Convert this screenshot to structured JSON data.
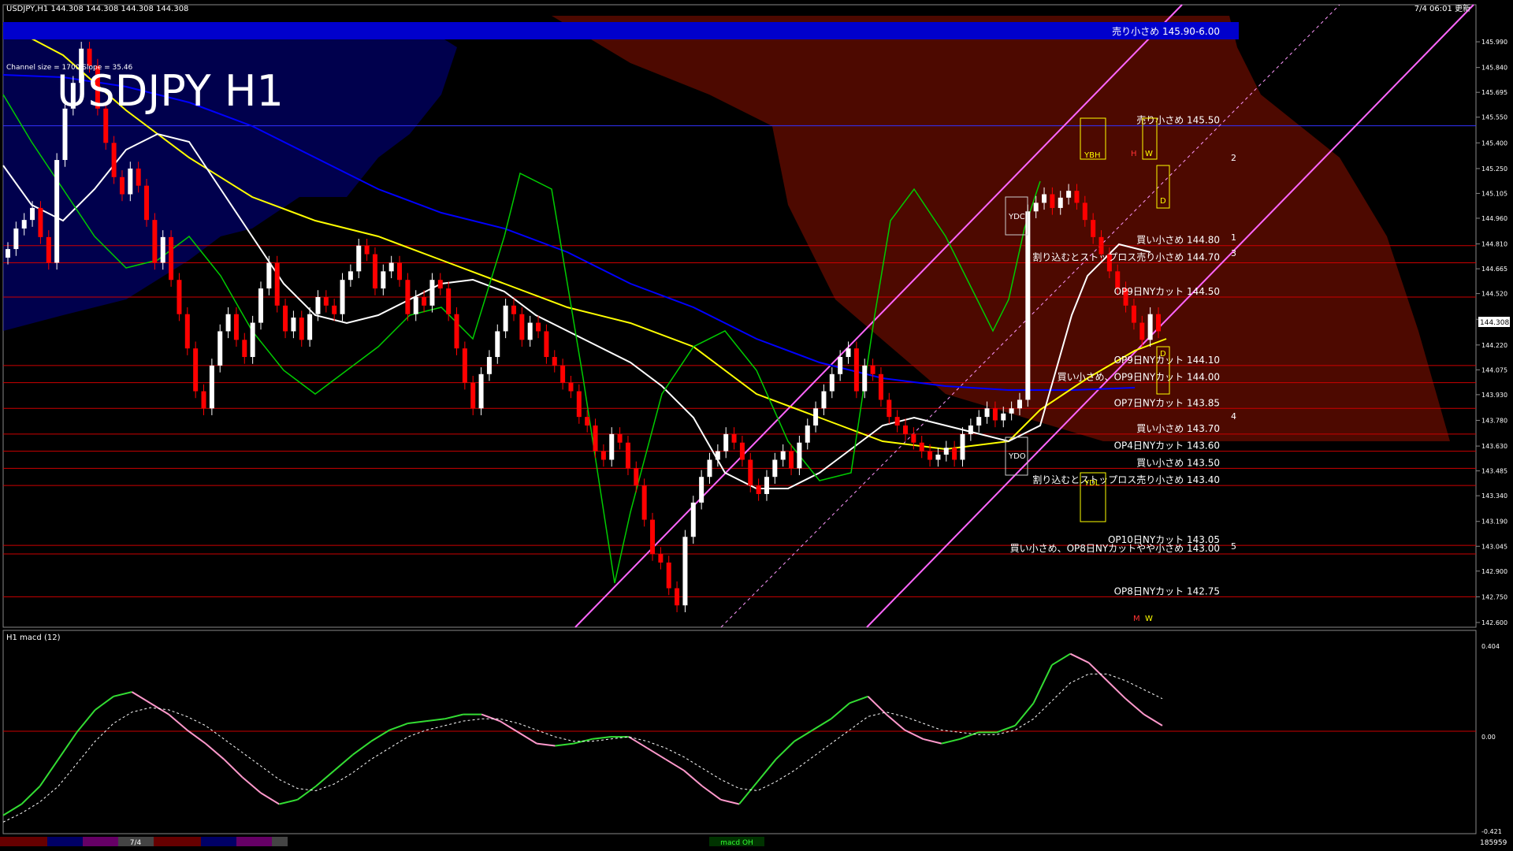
{
  "header": {
    "symbol_info": "USDJPY,H1  144.308 144.308 144.308 144.308",
    "time_info": "7/4 06:01 更新",
    "channel_info": "Channel size = 1700 Slope = 35.46",
    "big_title": "USDJPY H1",
    "current_price": "144.308"
  },
  "colors": {
    "background": "#000000",
    "bull_candle": "#ffffff",
    "bear_candle": "#ff0000",
    "sma_short": "#ffffff",
    "sma_mid": "#ffff00",
    "sma_long": "#0000ff",
    "chikou": "#00cc00",
    "channel": "#ff66ff",
    "level_line": "#cc0000",
    "band_banner": "#0000cc",
    "macd_up": "#33dd33",
    "macd_down": "#ff99cc",
    "macd_signal": "#ffffff"
  },
  "banner": {
    "label": "売り小さめ 145.90-6.00"
  },
  "markers": {
    "channel_numbers": [
      "1",
      "2",
      "3",
      "4",
      "5"
    ],
    "box_labels": [
      "YDC",
      "YDO",
      "YBH",
      "YDL",
      "D",
      "D",
      "W",
      "H",
      "M",
      "W"
    ]
  },
  "time_tabs": [
    "",
    "",
    "",
    "7/4",
    "",
    "",
    "",
    "",
    ""
  ],
  "status_item": "macd OH",
  "bottom_counter": "185959",
  "chart_data": {
    "type": "candlestick",
    "title": "USDJPY H1",
    "ylim": [
      142.6,
      146.05
    ],
    "y_ticks": [
      "145.990",
      "145.840",
      "145.695",
      "145.550",
      "145.400",
      "145.250",
      "145.105",
      "144.960",
      "144.810",
      "144.665",
      "144.520",
      "144.370",
      "144.220",
      "144.075",
      "143.930",
      "143.780",
      "143.630",
      "143.485",
      "143.340",
      "143.190",
      "143.045",
      "142.900",
      "142.750",
      "142.600"
    ],
    "closes": [
      144.78,
      144.9,
      144.95,
      145.02,
      144.85,
      144.7,
      145.3,
      145.6,
      145.75,
      145.95,
      145.85,
      145.6,
      145.4,
      145.2,
      145.1,
      145.25,
      145.15,
      144.95,
      144.7,
      144.85,
      144.6,
      144.4,
      144.2,
      143.95,
      143.85,
      144.1,
      144.3,
      144.4,
      144.25,
      144.15,
      144.35,
      144.55,
      144.7,
      144.45,
      144.3,
      144.38,
      144.25,
      144.4,
      144.5,
      144.45,
      144.4,
      144.6,
      144.65,
      144.8,
      144.75,
      144.55,
      144.65,
      144.7,
      144.6,
      144.4,
      144.5,
      144.45,
      144.6,
      144.55,
      144.4,
      144.2,
      144.0,
      143.85,
      144.05,
      144.15,
      144.3,
      144.45,
      144.4,
      144.25,
      144.35,
      144.3,
      144.15,
      144.1,
      144.0,
      143.95,
      143.8,
      143.75,
      143.6,
      143.55,
      143.7,
      143.65,
      143.5,
      143.4,
      143.2,
      143.0,
      142.95,
      142.8,
      142.7,
      143.1,
      143.3,
      143.45,
      143.55,
      143.6,
      143.7,
      143.65,
      143.55,
      143.4,
      143.35,
      143.45,
      143.55,
      143.6,
      143.5,
      143.65,
      143.75,
      143.85,
      143.95,
      144.05,
      144.15,
      144.2,
      143.95,
      144.1,
      144.05,
      143.9,
      143.8,
      143.75,
      143.7,
      143.65,
      143.6,
      143.55,
      143.58,
      143.62,
      143.55,
      143.7,
      143.75,
      143.8,
      143.85,
      143.78,
      143.82,
      143.85,
      143.9,
      145.0,
      145.05,
      145.1,
      145.02,
      145.08,
      145.12,
      145.05,
      144.95,
      144.85,
      144.75,
      144.65,
      144.55,
      144.45,
      144.35,
      144.25,
      144.4,
      144.3
    ],
    "levels": [
      {
        "price": 145.5,
        "label": "売り小さめ 145.50"
      },
      {
        "price": 144.8,
        "label": "買い小さめ 144.80"
      },
      {
        "price": 144.7,
        "label": "割り込むとストップロス売り小さめ 144.70"
      },
      {
        "price": 144.5,
        "label": "OP9日NYカット 144.50"
      },
      {
        "price": 144.1,
        "label": "OP9日NYカット 144.10"
      },
      {
        "price": 144.0,
        "label": "買い小さめ、OP9日NYカット 144.00"
      },
      {
        "price": 143.85,
        "label": "OP7日NYカット 143.85"
      },
      {
        "price": 143.7,
        "label": "買い小さめ 143.70"
      },
      {
        "price": 143.6,
        "label": "OP4日NYカット 143.60"
      },
      {
        "price": 143.5,
        "label": "買い小さめ 143.50"
      },
      {
        "price": 143.4,
        "label": "割り込むとストップロス売り小さめ 143.40"
      },
      {
        "price": 143.05,
        "label": "OP10日NYカット 143.05"
      },
      {
        "price": 143.0,
        "label": "買い小さめ、OP8日NYカットやや小さめ 143.00"
      },
      {
        "price": 142.75,
        "label": "OP8日NYカット 142.75"
      }
    ],
    "macd": {
      "title": "H1 macd (12)",
      "ticks": [
        "0.404",
        "0.00",
        "-0.421"
      ],
      "ylim": [
        -0.421,
        0.404
      ],
      "values": [
        -0.35,
        -0.3,
        -0.22,
        -0.1,
        0.02,
        0.12,
        0.18,
        0.2,
        0.15,
        0.1,
        0.03,
        -0.03,
        -0.1,
        -0.18,
        -0.25,
        -0.3,
        -0.28,
        -0.22,
        -0.15,
        -0.08,
        -0.02,
        0.03,
        0.06,
        0.07,
        0.08,
        0.1,
        0.1,
        0.07,
        0.02,
        -0.03,
        -0.04,
        -0.03,
        -0.01,
        0.0,
        0.0,
        -0.05,
        -0.1,
        -0.15,
        -0.22,
        -0.28,
        -0.3,
        -0.2,
        -0.1,
        -0.02,
        0.03,
        0.08,
        0.15,
        0.18,
        0.1,
        0.03,
        -0.01,
        -0.03,
        -0.01,
        0.02,
        0.02,
        0.05,
        0.15,
        0.32,
        0.37,
        0.33,
        0.25,
        0.17,
        0.1,
        0.05
      ],
      "signal": [
        -0.38,
        -0.34,
        -0.29,
        -0.22,
        -0.12,
        -0.02,
        0.06,
        0.11,
        0.13,
        0.12,
        0.09,
        0.05,
        -0.01,
        -0.07,
        -0.13,
        -0.19,
        -0.23,
        -0.24,
        -0.21,
        -0.16,
        -0.1,
        -0.05,
        0.0,
        0.03,
        0.05,
        0.07,
        0.08,
        0.08,
        0.06,
        0.03,
        0.0,
        -0.02,
        -0.02,
        -0.01,
        0.0,
        -0.02,
        -0.05,
        -0.09,
        -0.14,
        -0.19,
        -0.23,
        -0.24,
        -0.2,
        -0.15,
        -0.09,
        -0.03,
        0.03,
        0.09,
        0.11,
        0.09,
        0.06,
        0.03,
        0.02,
        0.01,
        0.01,
        0.03,
        0.08,
        0.16,
        0.24,
        0.28,
        0.28,
        0.25,
        0.21,
        0.17
      ]
    }
  }
}
